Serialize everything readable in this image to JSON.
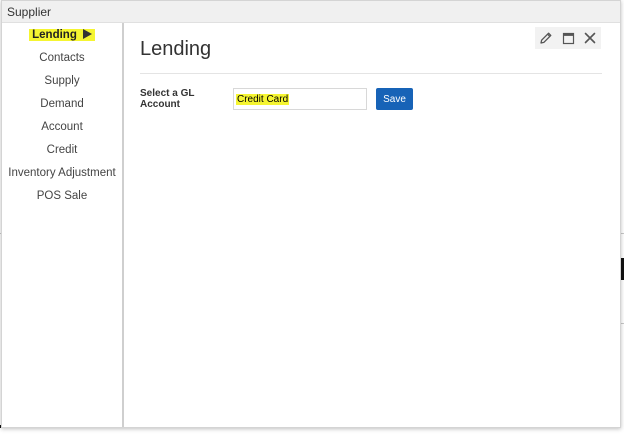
{
  "window": {
    "title": "Supplier"
  },
  "sidebar": {
    "items": [
      {
        "label": "Lending",
        "active": true
      },
      {
        "label": "Contacts"
      },
      {
        "label": "Supply"
      },
      {
        "label": "Demand"
      },
      {
        "label": "Account"
      },
      {
        "label": "Credit"
      },
      {
        "label": "Inventory Adjustment"
      },
      {
        "label": "POS Sale"
      }
    ]
  },
  "toolbar": {
    "icons": [
      "pencil-icon",
      "maximize-icon",
      "close-icon"
    ]
  },
  "main": {
    "title": "Lending",
    "gl_account_label": "Select a GL Account",
    "gl_account_value": "Credit Card",
    "save_label": "Save"
  },
  "colors": {
    "highlight": "#f5f531",
    "save_button": "#1763b7",
    "divider": "#cfcfcf"
  }
}
